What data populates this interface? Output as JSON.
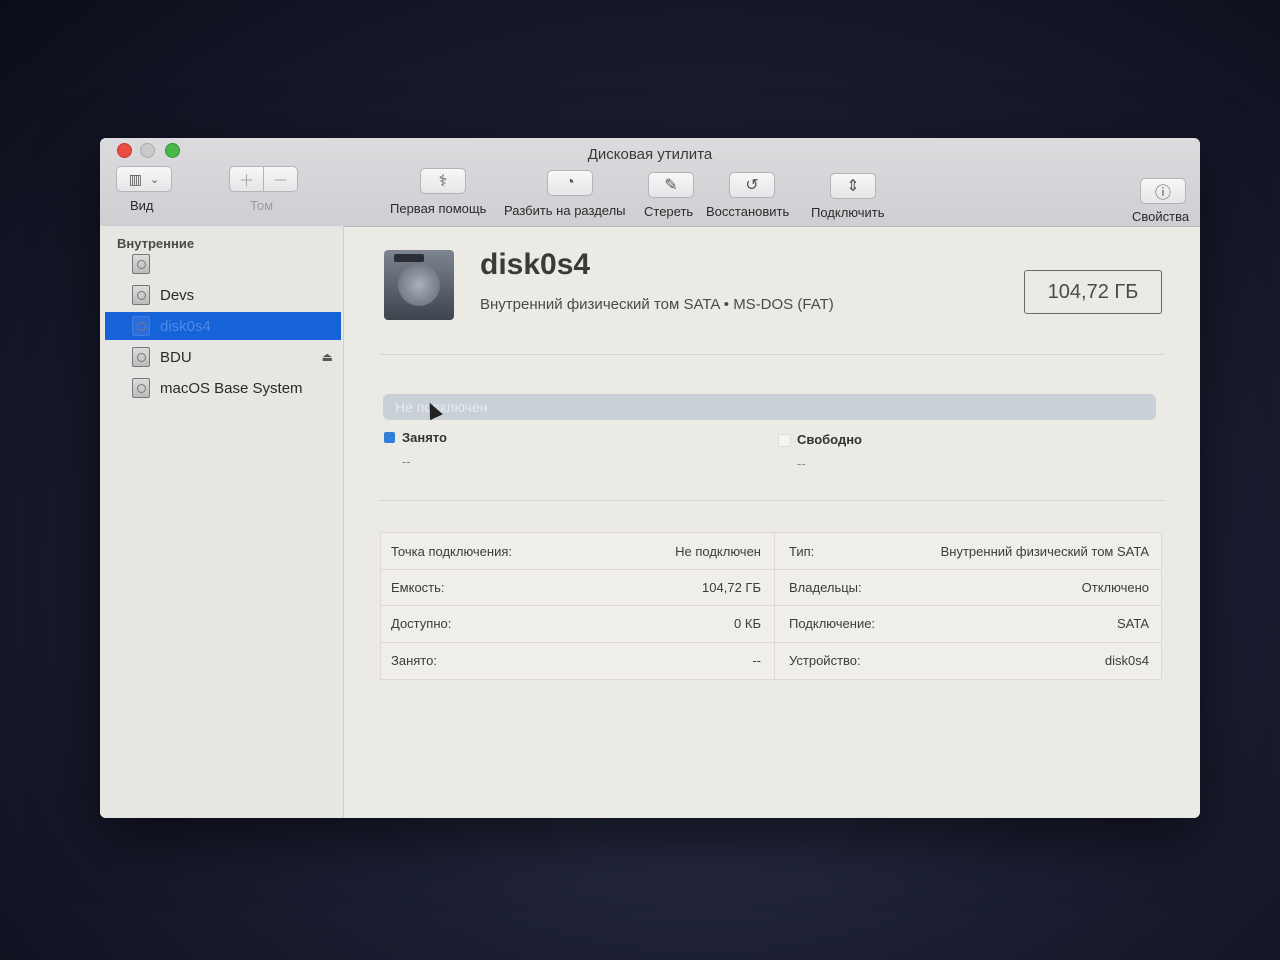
{
  "window": {
    "title": "Дисковая утилита"
  },
  "toolbar": {
    "view_label": "Вид",
    "volume_label": "Том",
    "first_aid_label": "Первая помощь",
    "partition_label": "Разбить на разделы",
    "erase_label": "Стереть",
    "restore_label": "Восстановить",
    "mount_label": "Подключить",
    "info_label": "Свойства"
  },
  "sidebar": {
    "section_title": "Внутренние",
    "items": [
      {
        "label": ""
      },
      {
        "label": "Devs"
      },
      {
        "label": "disk0s4"
      },
      {
        "label": "BDU"
      },
      {
        "label": "macOS Base System"
      }
    ]
  },
  "disk": {
    "name": "disk0s4",
    "subtitle": "Внутренний физический том SATA • MS-DOS (FAT)",
    "size": "104,72 ГБ"
  },
  "usage": {
    "bar_text": "Не подключен",
    "used_label": "Занято",
    "used_value": "--",
    "free_label": "Свободно",
    "free_value": "--",
    "used_color": "#2f7fd6",
    "free_color": "#f4f4f0"
  },
  "info": {
    "left": [
      {
        "key": "Точка подключения:",
        "value": "Не подключен"
      },
      {
        "key": "Емкость:",
        "value": "104,72 ГБ"
      },
      {
        "key": "Доступно:",
        "value": "0 КБ"
      },
      {
        "key": "Занято:",
        "value": "--"
      }
    ],
    "right": [
      {
        "key": "Тип:",
        "value": "Внутренний физический том SATA"
      },
      {
        "key": "Владельцы:",
        "value": "Отключено"
      },
      {
        "key": "Подключение:",
        "value": "SATA"
      },
      {
        "key": "Устройство:",
        "value": "disk0s4"
      }
    ]
  }
}
